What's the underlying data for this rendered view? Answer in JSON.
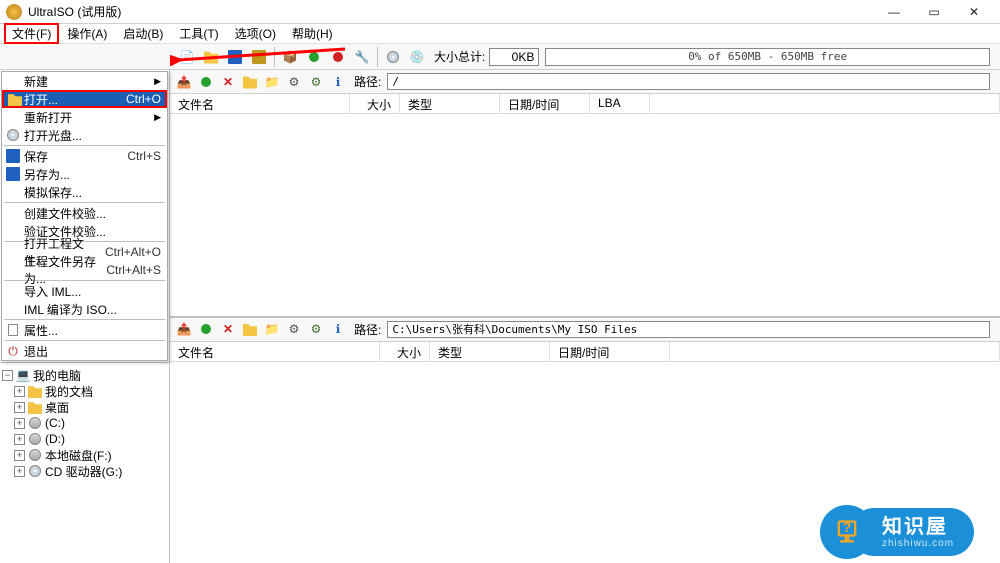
{
  "title": "UltraISO (试用版)",
  "menubar": [
    "文件(F)",
    "操作(A)",
    "启动(B)",
    "工具(T)",
    "选项(O)",
    "帮助(H)"
  ],
  "toolbar": {
    "size_label": "大小总计:",
    "size_value": "0KB",
    "progress_text": "0% of 650MB - 650MB free"
  },
  "file_menu": [
    {
      "type": "item",
      "label": "新建",
      "arrow": true
    },
    {
      "type": "item",
      "label": "打开...",
      "shortcut": "Ctrl+O",
      "selected": true,
      "hl": true,
      "icon": "folder"
    },
    {
      "type": "item",
      "label": "重新打开",
      "arrow": true
    },
    {
      "type": "item",
      "label": "打开光盘...",
      "icon": "cd"
    },
    {
      "type": "sep"
    },
    {
      "type": "item",
      "label": "保存",
      "shortcut": "Ctrl+S",
      "icon": "save"
    },
    {
      "type": "item",
      "label": "另存为...",
      "icon": "save"
    },
    {
      "type": "item",
      "label": "模拟保存..."
    },
    {
      "type": "sep"
    },
    {
      "type": "item",
      "label": "创建文件校验..."
    },
    {
      "type": "item",
      "label": "验证文件校验..."
    },
    {
      "type": "sep"
    },
    {
      "type": "item",
      "label": "打开工程文件...",
      "shortcut": "Ctrl+Alt+O"
    },
    {
      "type": "item",
      "label": "工程文件另存为...",
      "shortcut": "Ctrl+Alt+S"
    },
    {
      "type": "sep"
    },
    {
      "type": "item",
      "label": "导入 IML..."
    },
    {
      "type": "item",
      "label": "IML 编译为 ISO..."
    },
    {
      "type": "sep"
    },
    {
      "type": "item",
      "label": "属性...",
      "icon": "doc"
    },
    {
      "type": "sep"
    },
    {
      "type": "item",
      "label": "退出",
      "icon": "exit"
    }
  ],
  "top_pane": {
    "path_label": "路径:",
    "path_value": "/",
    "cols": [
      "文件名",
      "大小",
      "类型",
      "日期/时间",
      "LBA"
    ]
  },
  "bottom_pane": {
    "path_label": "路径:",
    "path_value": "C:\\Users\\张有科\\Documents\\My ISO Files",
    "cols": [
      "文件名",
      "大小",
      "类型",
      "日期/时间"
    ]
  },
  "tree": [
    {
      "label": "我的文档",
      "icon": "folder",
      "expander": "+"
    },
    {
      "label": "桌面",
      "icon": "folder",
      "expander": "+"
    },
    {
      "label": "(C:)",
      "icon": "disk",
      "expander": "+"
    },
    {
      "label": "(D:)",
      "icon": "disk",
      "expander": "+"
    },
    {
      "label": "本地磁盘(F:)",
      "icon": "disk",
      "expander": "+"
    },
    {
      "label": "CD 驱动器(G:)",
      "icon": "cd",
      "expander": "+"
    }
  ],
  "tree_root": "我的电脑",
  "watermark": {
    "cn": "知识屋",
    "url": "zhishiwu.com"
  }
}
